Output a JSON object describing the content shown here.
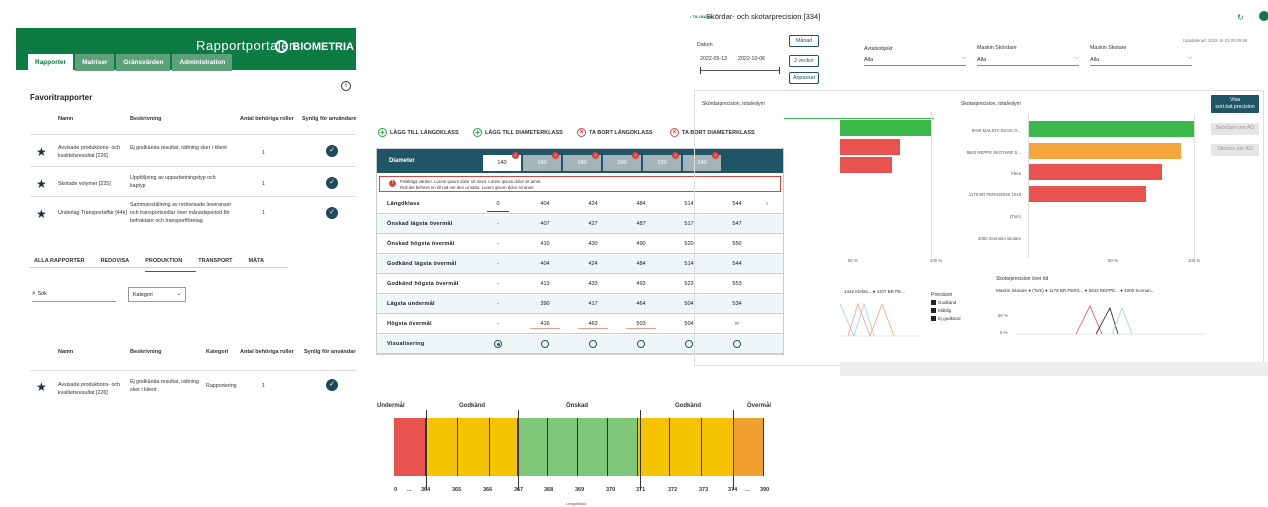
{
  "portal": {
    "title": "Rapportportalen",
    "logo": "BIOMETRIA",
    "tabs": [
      "Rapporter",
      "Matriser",
      "Gränsvärden",
      "Administration"
    ],
    "favorites_heading": "Favoritrapporter",
    "columns": [
      "Namn",
      "Beskrivning",
      "Antal behöriga roller",
      "Synlig för användare"
    ],
    "favorites": [
      {
        "name": "Avvisade produktions- och kvalitetsresultat [226]",
        "desc": "Ej godkända resultat, rättning sker i klient",
        "roles": "1"
      },
      {
        "name": "Skotade volymer [225]",
        "desc": "Uppföljning av upparbetningstyp och kaptyp",
        "roles": "1"
      },
      {
        "name": "Underlag Transportaffär [44k]",
        "desc": "Sammanställning av redovisade leveranser och transportsedlar över månadsperiod för befraktare och transportföretag",
        "roles": "1"
      }
    ],
    "subtabs": [
      "ALLA RAPPORTER",
      "REDOVISA",
      "PRODUKTION",
      "TRANSPORT",
      "MÄTA"
    ],
    "search_placeholder": "Sök",
    "category_select": "Kategori",
    "columns2": [
      "Namn",
      "Beskrivning",
      "Kategori",
      "Antal behöriga roller",
      "Synlig för användare"
    ],
    "results": [
      {
        "name": "Avvisade produktions- och kvalitetsresultat [226]",
        "desc": "Ej godkända resultat, rättning sker i klient",
        "category": "Rapportering",
        "roles": "1"
      }
    ]
  },
  "diameter": {
    "actions": [
      "LÄGG TILL LÄNGDKLASS",
      "LÄGG TILL DIAMETERKLASS",
      "TA BORT LÄNGDKLASS",
      "TA BORT DIAMETERKLASS"
    ],
    "header_label": "Diameter",
    "diam_tabs": [
      "140",
      "160",
      "180",
      "200",
      "220",
      "240"
    ],
    "error_line1": "Felaktiga värden. Lorem ipsum dolor sit amet. Lorem ipsum dolor sit amet.",
    "error_line2": "Roll det behövs en till rad ner den ut sätta. Lorem ipsum dolor sit amet.",
    "rows": [
      {
        "label": "Längdklass",
        "values": [
          "0",
          "404",
          "424",
          "484",
          "514",
          "544"
        ],
        "arrow": "›"
      },
      {
        "label": "Önskad lägsta övermål",
        "values": [
          "-",
          "407",
          "427",
          "487",
          "517",
          "547"
        ]
      },
      {
        "label": "Önskad högsta övermål",
        "values": [
          "-",
          "410",
          "430",
          "490",
          "520",
          "550"
        ]
      },
      {
        "label": "Godkänd lägsta övermål",
        "values": [
          "-",
          "404",
          "424",
          "484",
          "514",
          "544"
        ]
      },
      {
        "label": "Godkänd högsta övermål",
        "values": [
          "-",
          "413",
          "433",
          "493",
          "523",
          "553"
        ]
      },
      {
        "label": "Lägsta undermål",
        "values": [
          "-",
          "390",
          "417",
          "464",
          "504",
          "534"
        ]
      },
      {
        "label": "Högsta övermål",
        "values": [
          "-",
          "416",
          "463",
          "503",
          "504",
          "∞"
        ]
      },
      {
        "label": "Visualisering",
        "values": []
      }
    ],
    "scale_labels": [
      "Undermål",
      "Godkänd",
      "Önskad",
      "Godkänd",
      "Övermål"
    ],
    "scale_ticks": [
      "0",
      "...",
      "364",
      "365",
      "366",
      "367",
      "368",
      "369",
      "370",
      "371",
      "372",
      "373",
      "374",
      "...",
      "390"
    ],
    "scale_unit": "Längdklass",
    "colors": {
      "red": "#e8524f",
      "yellow": "#f5c300",
      "green": "#80c77a",
      "orange": "#f0a030"
    }
  },
  "dashboard": {
    "back": "TILLBAKA",
    "title": "Skördar- och skotarprecision [334]",
    "updated": "Uppdaterad: 2022-11-23 09:29:56",
    "date_label": "Datum",
    "date_from": "2022-05-13",
    "date_to": "2022-10-06",
    "period_buttons": [
      "Månad",
      "2 veckor",
      "Anpassat"
    ],
    "filters": [
      {
        "label": "Avtalsobjekt",
        "value": "Alla"
      },
      {
        "label": "Maskin Skördare",
        "value": "Alla"
      },
      {
        "label": "Maskin Skotare",
        "value": "Alla"
      }
    ],
    "left_chart_title": "Skördarprecision, totalvolym",
    "right_chart_title": "Skotarprecision, totalvolym",
    "right_chart_labels": [
      "9040 MALSTA SKOG O...",
      "5843 REPPE SKOTARE S...",
      "Flera",
      "1178 BR PERSSONS 1018",
      "(Tom)",
      "4000 Scenario skotare"
    ],
    "axis_ticks": [
      "50 %",
      "100 %"
    ],
    "side_buttons": [
      "Visa sort.kat.precision",
      "Skördare per AO",
      "Skotare per AO"
    ],
    "legend_title": "Precision",
    "legend_items": [
      "Godkänd",
      "Måttlig",
      "Ej godkänd"
    ],
    "time_chart_title": "Skotarprecision över tid",
    "time_legend": "Maskin Skotare ● (Tom) ● 1178 BR PERS... ● 5843 REPPE... ● 4000 Scenari...",
    "left_time_legend": "1442 Klefas... ● 1107 BR PE...",
    "time_ticks": [
      "50 %",
      "0 %"
    ]
  }
}
